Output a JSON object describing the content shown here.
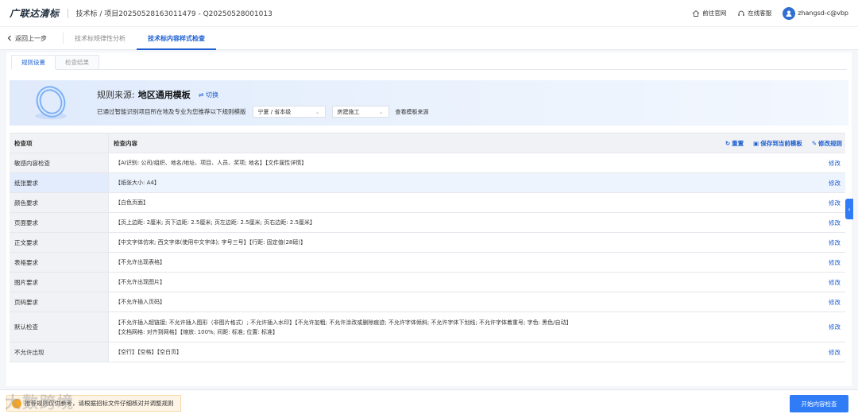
{
  "header": {
    "brand": "广联达清标",
    "breadcrumb": "技术标 / 项目20250528163011479 - Q20250528001013",
    "links": {
      "official_site": "前往官网",
      "support": "在线客服"
    },
    "user": "zhangsd-c@vbp"
  },
  "nav": {
    "back_label": "返回上一步",
    "tabs": [
      {
        "label": "技术标规律性分析",
        "active": false
      },
      {
        "label": "技术标内容样式检查",
        "active": true
      }
    ]
  },
  "subtabs": [
    {
      "label": "规则设置",
      "active": true
    },
    {
      "label": "检查结果",
      "active": false
    }
  ],
  "banner": {
    "source_label": "规则来源:",
    "source_name": "地区通用模板",
    "switch_label": "切换",
    "recommend_text": "已通过智能识别项目所在地及专业为您推荐以下规则模版",
    "region_select": "宁夏 / 省本级",
    "major_select": "房建施工",
    "view_source": "查看模板来源"
  },
  "table": {
    "headers": {
      "item": "检查项",
      "content": "检查内容"
    },
    "actions": {
      "reset": "重置",
      "save": "保存到当前模板",
      "modify": "修改规则"
    },
    "edit_label": "修改",
    "rows": [
      {
        "item": "敏感内容检查",
        "lines": [
          "【AI识别: 公司/组织、地名/地址、项目、人员、奖项; 地名】【文件属性详情】"
        ]
      },
      {
        "item": "纸张要求",
        "lines": [
          "【纸张大小: A4】"
        ]
      },
      {
        "item": "颜色要求",
        "lines": [
          "【白色页面】"
        ]
      },
      {
        "item": "页面要求",
        "lines": [
          "【页上边距: 2厘米; 页下边距: 2.5厘米; 页左边距: 2.5厘米; 页右边距: 2.5厘米】"
        ]
      },
      {
        "item": "正文要求",
        "lines": [
          "【中文字体仿宋; 西文字体(使用中文字体); 字号三号】【行距: 固定值(28磅)】"
        ]
      },
      {
        "item": "表格要求",
        "lines": [
          "【不允许出现表格】"
        ]
      },
      {
        "item": "图片要求",
        "lines": [
          "【不允许出现图片】"
        ]
      },
      {
        "item": "页码要求",
        "lines": [
          "【不允许插入页码】"
        ]
      },
      {
        "item": "默认检查",
        "lines": [
          "【不允许插入超链接; 不允许插入图形（非图片格式）; 不允许插入水印】【不允许加粗; 不允许涂改或删除痕迹; 不允许字体倾斜; 不允许字体下划线; 不允许字体着重号; 字色: 黑色/自动】",
          "【文档网格: 对齐到网格】【缩放: 100%; 间距: 标准; 位置: 标准】"
        ]
      },
      {
        "item": "不允许出现",
        "lines": [
          "【空行】【空格】【空白页】"
        ]
      }
    ]
  },
  "footer": {
    "tip": "推荐规则仅供参考，请根据招标文件仔细核对并调整规则",
    "start_button": "开始内容检查"
  },
  "watermark": "大数跨境",
  "colors": {
    "primary": "#2f7cf6",
    "link": "#1d5fd1",
    "tip_bg": "#fff5e6"
  }
}
